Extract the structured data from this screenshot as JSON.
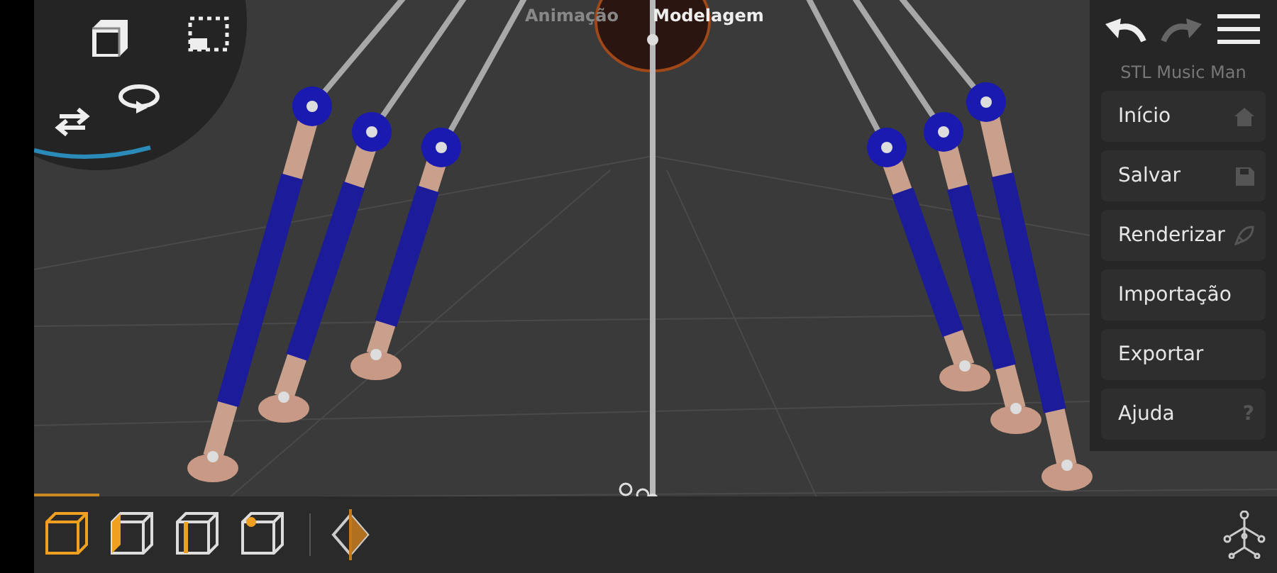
{
  "mode_tabs": [
    {
      "label": "Animação",
      "selected": false
    },
    {
      "label": "Modelagem",
      "selected": true
    }
  ],
  "history": [
    {
      "kind": "undo",
      "disabled": false
    },
    {
      "kind": "redo",
      "disabled": true
    }
  ],
  "project_title": "STL Music Man",
  "menu_items": [
    {
      "label": "Início",
      "kind": "home"
    },
    {
      "label": "Salvar",
      "kind": "save"
    },
    {
      "label": "Renderizar",
      "kind": "render"
    },
    {
      "label": "Importação",
      "kind": "plain"
    },
    {
      "label": "Exportar",
      "kind": "plain"
    },
    {
      "label": "Ajuda",
      "kind": "help",
      "symbol": "?"
    }
  ],
  "selection_modes": [
    {
      "kind": "object",
      "selected": true
    },
    {
      "kind": "face",
      "selected": false
    },
    {
      "kind": "edge",
      "selected": false
    },
    {
      "kind": "vertex",
      "selected": false
    }
  ]
}
